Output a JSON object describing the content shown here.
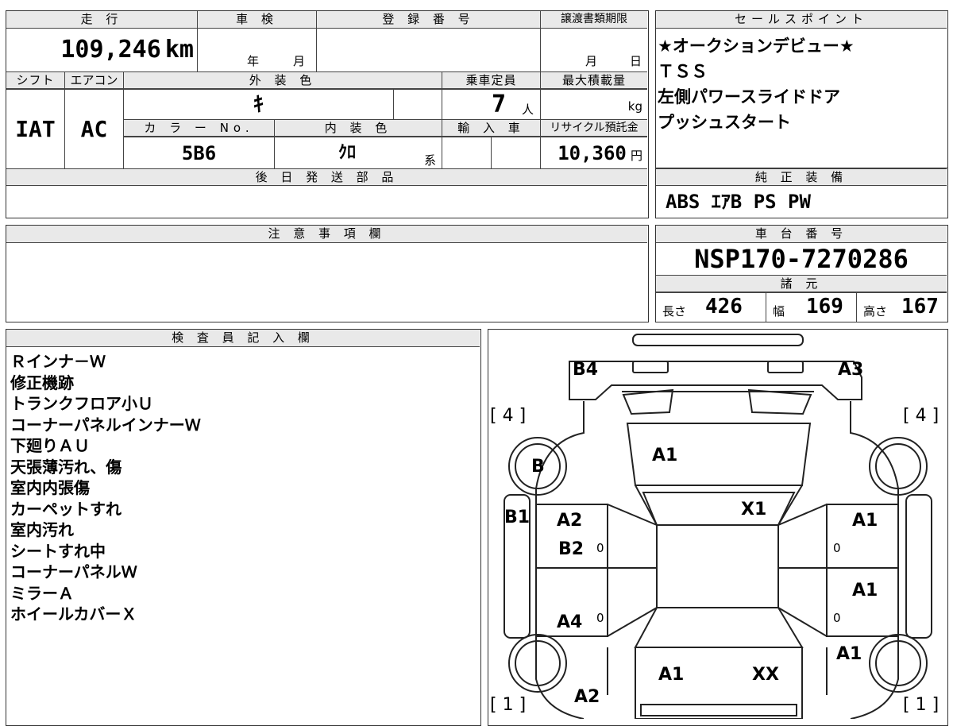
{
  "mileage": {
    "label": "走 行",
    "value": "109,246",
    "unit": "km"
  },
  "inspection": {
    "label": "車 検",
    "year_unit": "年",
    "month_unit": "月"
  },
  "registration_no": {
    "label": "登 録 番 号",
    "value": ""
  },
  "transfer_deadline": {
    "label": "譲渡書類期限",
    "month_unit": "月",
    "day_unit": "日"
  },
  "sales_points": {
    "label": "セールスポイント",
    "items": [
      "★オークションデビュー★",
      "ＴＳＳ",
      "左側パワースライドドア",
      "プッシュスタート"
    ]
  },
  "shift": {
    "label": "シフト",
    "value": "IAT"
  },
  "aircon": {
    "label": "エアコン",
    "value": "AC"
  },
  "exterior_color": {
    "label": "外 装 色",
    "value": "ｷ"
  },
  "capacity": {
    "label": "乗車定員",
    "value": "7",
    "unit": "人"
  },
  "max_load": {
    "label": "最大積載量",
    "unit": "kg"
  },
  "color_no": {
    "label": "カ ラ ー No.",
    "value": "5B6"
  },
  "interior_color": {
    "label": "内 装 色",
    "value": "ｸﾛ",
    "unit": "系"
  },
  "import": {
    "label": "輸 入 車"
  },
  "recycle_fee": {
    "label": "リサイクル預託金",
    "value": "10,360",
    "unit": "円"
  },
  "later_parts": {
    "label": "後 日 発 送 部 品"
  },
  "standard_equipment": {
    "label": "純 正 装 備",
    "value": "ABS ｴｱB PS PW"
  },
  "caution": {
    "label": "注 意 事 項 欄"
  },
  "chassis_no": {
    "label": "車 台 番 号",
    "value": "NSP170-7270286"
  },
  "specs": {
    "label": "諸 元",
    "length_label": "長さ",
    "length": "426",
    "width_label": "幅",
    "width": "169",
    "height_label": "高さ",
    "height": "167"
  },
  "inspector": {
    "label": "検 査 員 記 入 欄",
    "notes": [
      "Ｒインナ－Ｗ",
      "修正機跡",
      "トランクフロア小Ｕ",
      "コーナーパネルインナーＷ",
      "下廻りＡＵ",
      "天張薄汚れ、傷",
      "室内内張傷",
      "カーペットすれ",
      "室内汚れ",
      "シートすれ中",
      "コーナーパネルＷ",
      "ミラーＡ",
      "ホイールカバーＸ"
    ]
  },
  "diagram": {
    "labels": {
      "b4": "B4",
      "a3": "A3",
      "a1_hood": "A1",
      "b_wheel": "B",
      "b1": "B1",
      "x1": "X1",
      "a2_front": "A2",
      "b2": "B2",
      "a1_rf": "A1",
      "a1_rr": "A1",
      "a4": "A4",
      "a1_rr2": "A1",
      "a1_rear": "A1",
      "xx": "XX",
      "a2_rear": "A2",
      "zero1": "0",
      "zero2": "0",
      "zero3": "0",
      "zero4": "0"
    },
    "tire_front_left": "[ 4 ]",
    "tire_front_right": "[ 4 ]",
    "tire_rear_left": "[ 1 ]",
    "tire_rear_right": "[ 1 ]"
  }
}
